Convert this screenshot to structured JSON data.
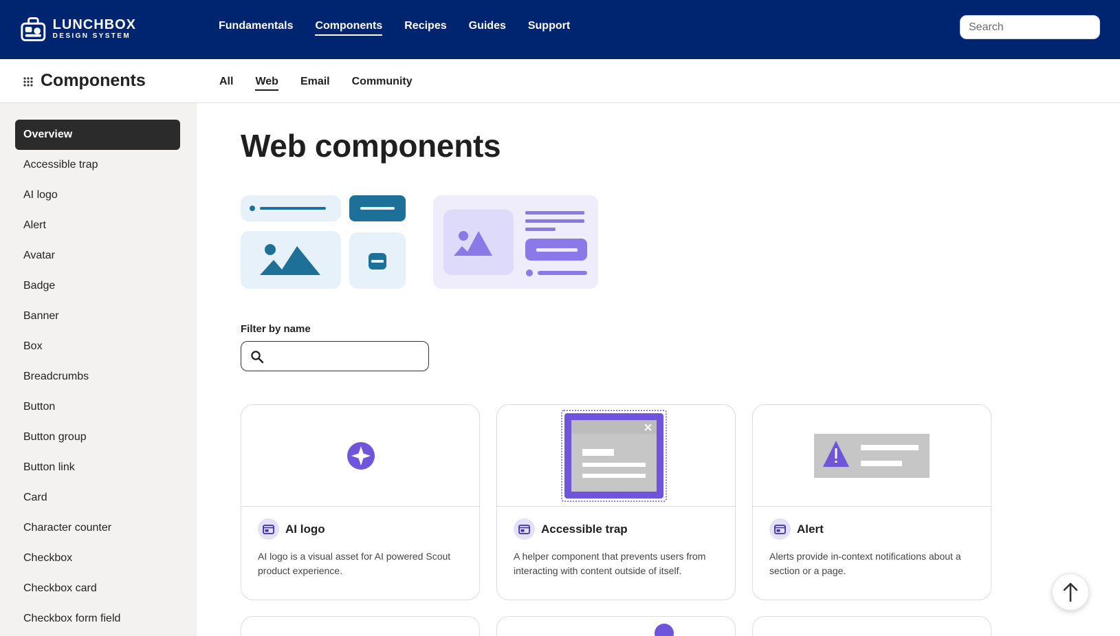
{
  "brand": {
    "name_line1": "LUNCHBOX",
    "name_line2": "DESIGN SYSTEM",
    "logo_icon": "lunchbox-icon"
  },
  "main_nav": {
    "items": [
      {
        "label": "Fundamentals",
        "active": false
      },
      {
        "label": "Components",
        "active": true
      },
      {
        "label": "Recipes",
        "active": false
      },
      {
        "label": "Guides",
        "active": false
      },
      {
        "label": "Support",
        "active": false
      }
    ]
  },
  "search": {
    "placeholder": "Search",
    "value": ""
  },
  "section": {
    "title": "Components",
    "icon": "grid-icon"
  },
  "sub_nav": {
    "items": [
      {
        "label": "All",
        "active": false
      },
      {
        "label": "Web",
        "active": true
      },
      {
        "label": "Email",
        "active": false
      },
      {
        "label": "Community",
        "active": false
      }
    ]
  },
  "sidebar": {
    "items": [
      {
        "label": "Overview",
        "active": true
      },
      {
        "label": "Accessible trap"
      },
      {
        "label": "AI logo"
      },
      {
        "label": "Alert"
      },
      {
        "label": "Avatar"
      },
      {
        "label": "Badge"
      },
      {
        "label": "Banner"
      },
      {
        "label": "Box"
      },
      {
        "label": "Breadcrumbs"
      },
      {
        "label": "Button"
      },
      {
        "label": "Button group"
      },
      {
        "label": "Button link"
      },
      {
        "label": "Card"
      },
      {
        "label": "Character counter"
      },
      {
        "label": "Checkbox"
      },
      {
        "label": "Checkbox card"
      },
      {
        "label": "Checkbox form field"
      }
    ]
  },
  "page": {
    "title": "Web components"
  },
  "filter": {
    "label": "Filter by name",
    "placeholder": "",
    "value": "",
    "icon": "search-icon"
  },
  "cards": [
    {
      "title": "AI logo",
      "description": "AI logo is a visual asset for AI powered Scout product experience.",
      "icon": "component-icon"
    },
    {
      "title": "Accessible trap",
      "description": "A helper component that prevents users from interacting with content outside of itself.",
      "icon": "component-icon"
    },
    {
      "title": "Alert",
      "description": "Alerts provide in-context notifications about a section or a page.",
      "icon": "component-icon"
    }
  ],
  "back_to_top": {
    "icon": "arrow-up-icon"
  },
  "colors": {
    "topbar": "#002570",
    "sidebar_bg": "#f3f2f1",
    "active_item": "#2b2b2b",
    "accent_purple": "#6e55dc",
    "accent_teal": "#1d7198"
  }
}
